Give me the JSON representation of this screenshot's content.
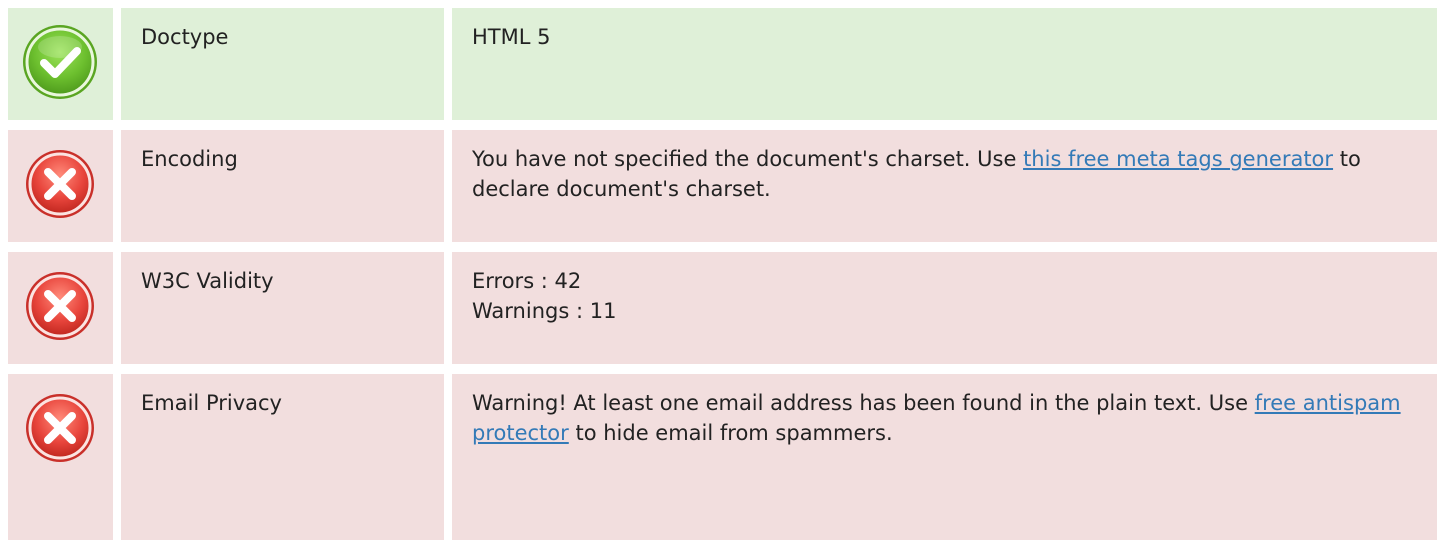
{
  "rows": [
    {
      "status": "pass",
      "icon": "check-circle-icon",
      "label": "Doctype",
      "value": "HTML 5"
    },
    {
      "status": "fail",
      "icon": "x-circle-icon",
      "label": "Encoding",
      "text_before": "You have not specified the document's charset. Use ",
      "link_text": "this free meta tags generator",
      "text_after": " to declare document's charset."
    },
    {
      "status": "fail",
      "icon": "x-circle-icon",
      "label": "W3C Validity",
      "errors": "Errors : 42",
      "warnings": "Warnings : 11"
    },
    {
      "status": "fail",
      "icon": "x-circle-icon",
      "label": "Email Privacy",
      "text_before": "Warning! At least one email address has been found in the plain text. Use ",
      "link_text": "free antispam protector",
      "text_after": " to hide email from spammers."
    }
  ],
  "colors": {
    "pass_bg": "#dff0d8",
    "fail_bg": "#f2dede",
    "link": "#337ab7",
    "pass_icon": "#6cbf2e",
    "fail_icon": "#e8453c"
  }
}
